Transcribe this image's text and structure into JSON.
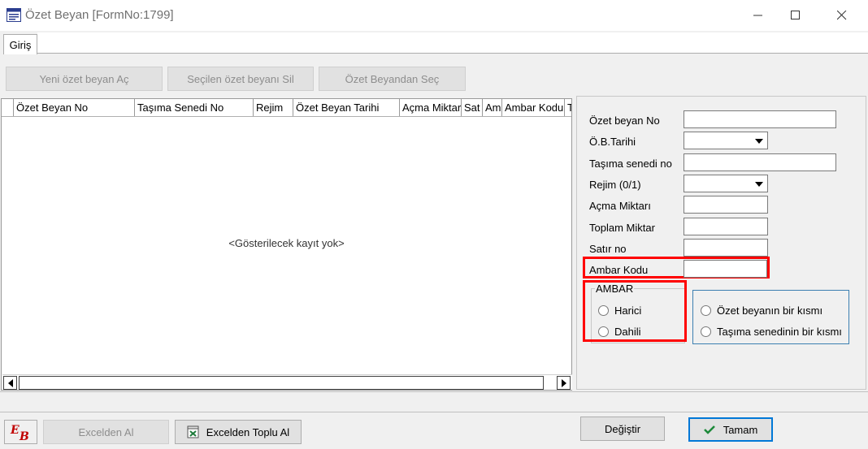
{
  "window": {
    "title": "Özet Beyan [FormNo:1799]",
    "minimize": "–",
    "maximize": "☐",
    "close": "✕"
  },
  "tabs": [
    {
      "label": "Giriş"
    }
  ],
  "toolbar": {
    "new_label": "Yeni özet beyan Aç",
    "delete_label": "Seçilen özet beyanı Sil",
    "select_label": "Özet Beyandan Seç"
  },
  "grid": {
    "columns": [
      "Özet Beyan No",
      "Taşıma Senedi No",
      "Rejim",
      "Özet Beyan Tarihi",
      "Açma Miktarı",
      "Sat",
      "Am",
      "Ambar Kodu",
      "T"
    ],
    "empty_message": "<Gösterilecek kayıt yok>"
  },
  "form": {
    "ozet_beyan_no_label": "Özet beyan No",
    "ob_tarihi_label": "Ö.B.Tarihi",
    "tasima_senedi_no_label": "Taşıma senedi no",
    "rejim_label": "Rejim  (0/1)",
    "acma_miktari_label": "Açma Miktarı",
    "toplam_miktar_label": "Toplam Miktar",
    "satir_no_label": "Satır no",
    "ambar_kodu_label": "Ambar Kodu",
    "ambar_group_label": "AMBAR",
    "harici_label": "Harici",
    "dahili_label": "Dahili",
    "ozet_beyanin_label": "Özet beyanın bir kısmı",
    "tasima_senedinin_label": "Taşıma senedinin bir kısmı"
  },
  "footer": {
    "logo_text": "EB",
    "excel_al_label": "Excelden Al",
    "excel_toplu_label": "Excelden Toplu Al",
    "degistir_label": "Değiştir",
    "tamam_label": "Tamam"
  },
  "colors": {
    "highlight": "#ff0000",
    "accent": "#0078d7"
  }
}
